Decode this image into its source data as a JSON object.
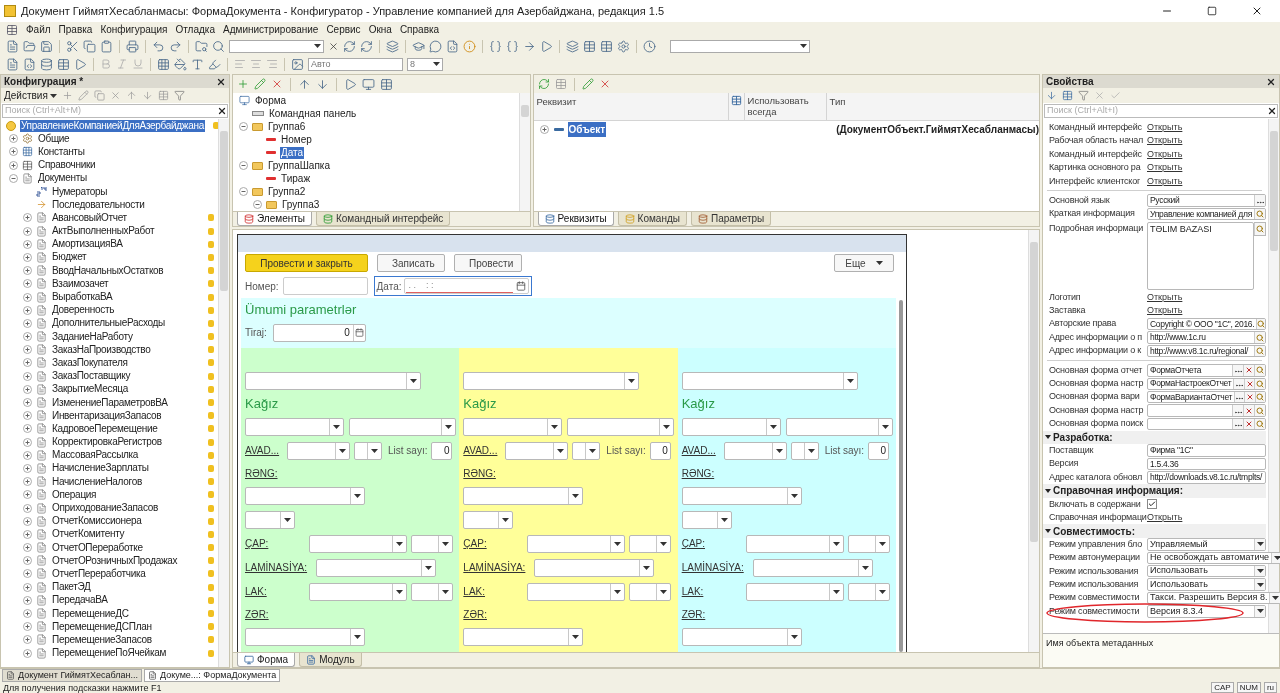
{
  "window": {
    "title": "Документ ГиймятХесабланмасы: ФормаДокумента - Конфигуратор - Управление компанией для Азербайджана, редакция 1.5"
  },
  "menu": [
    "Файл",
    "Правка",
    "Конфигурация",
    "Отладка",
    "Администрирование",
    "Сервис",
    "Окна",
    "Справка"
  ],
  "toolbar": {
    "font_field": "Авто",
    "size_field": "8"
  },
  "config_panel": {
    "title": "Конфигурация *",
    "actions": "Действия",
    "search": {
      "placeholder": "Поиск (Ctrl+Alt+M)"
    },
    "tree": [
      {
        "label": "УправлениеКомпаниейДляАзербайджана",
        "kind": "root",
        "selected": true,
        "locked": true,
        "children": [
          {
            "label": "Общие",
            "kind": "common",
            "selected": false,
            "locked": false,
            "expanded": false
          },
          {
            "label": "Константы",
            "kind": "constants",
            "selected": false,
            "locked": false,
            "expanded": false
          },
          {
            "label": "Справочники",
            "kind": "catalogs",
            "selected": false,
            "locked": false,
            "expanded": false
          },
          {
            "label": "Документы",
            "kind": "documents",
            "selected": false,
            "locked": false,
            "expanded": true,
            "children": [
              {
                "label": "Нумераторы",
                "kind": "numerators",
                "selected": false,
                "locked": false
              },
              {
                "label": "Последовательности",
                "kind": "sequences",
                "selected": false,
                "locked": false
              },
              {
                "label": "АвансовыйОтчет",
                "kind": "document",
                "selected": false,
                "locked": true,
                "expanded": false
              },
              {
                "label": "АктВыполненныхРабот",
                "kind": "document",
                "selected": false,
                "locked": true,
                "expanded": false
              },
              {
                "label": "АмортизацияВА",
                "kind": "document",
                "selected": false,
                "locked": true,
                "expanded": false
              },
              {
                "label": "Бюджет",
                "kind": "document",
                "selected": false,
                "locked": true,
                "expanded": false
              },
              {
                "label": "ВводНачальныхОстатков",
                "kind": "document",
                "selected": false,
                "locked": true,
                "expanded": false
              },
              {
                "label": "Взаимозачет",
                "kind": "document",
                "selected": false,
                "locked": true,
                "expanded": false
              },
              {
                "label": "ВыработкаВА",
                "kind": "document",
                "selected": false,
                "locked": true,
                "expanded": false
              },
              {
                "label": "Доверенность",
                "kind": "document",
                "selected": false,
                "locked": true,
                "expanded": false
              },
              {
                "label": "ДополнительныеРасходы",
                "kind": "document",
                "selected": false,
                "locked": true,
                "expanded": false
              },
              {
                "label": "ЗаданиеНаРаботу",
                "kind": "document",
                "selected": false,
                "locked": true,
                "expanded": false
              },
              {
                "label": "ЗаказНаПроизводство",
                "kind": "document",
                "selected": false,
                "locked": true,
                "expanded": false
              },
              {
                "label": "ЗаказПокупателя",
                "kind": "document",
                "selected": false,
                "locked": true,
                "expanded": false
              },
              {
                "label": "ЗаказПоставщику",
                "kind": "document",
                "selected": false,
                "locked": true,
                "expanded": false
              },
              {
                "label": "ЗакрытиеМесяца",
                "kind": "document",
                "selected": false,
                "locked": true,
                "expanded": false
              },
              {
                "label": "ИзменениеПараметровВА",
                "kind": "document",
                "selected": false,
                "locked": true,
                "expanded": false
              },
              {
                "label": "ИнвентаризацияЗапасов",
                "kind": "document",
                "selected": false,
                "locked": true,
                "expanded": false
              },
              {
                "label": "КадровоеПеремещение",
                "kind": "document",
                "selected": false,
                "locked": true,
                "expanded": false
              },
              {
                "label": "КорректировкаРегистров",
                "kind": "document",
                "selected": false,
                "locked": true,
                "expanded": false
              },
              {
                "label": "МассоваяРассылка",
                "kind": "document",
                "selected": false,
                "locked": true,
                "expanded": false
              },
              {
                "label": "НачислениеЗарплаты",
                "kind": "document",
                "selected": false,
                "locked": true,
                "expanded": false
              },
              {
                "label": "НачислениеНалогов",
                "kind": "document",
                "selected": false,
                "locked": true,
                "expanded": false
              },
              {
                "label": "Операция",
                "kind": "document",
                "selected": false,
                "locked": true,
                "expanded": false
              },
              {
                "label": "ОприходованиеЗапасов",
                "kind": "document",
                "selected": false,
                "locked": true,
                "expanded": false
              },
              {
                "label": "ОтчетКомиссионера",
                "kind": "document",
                "selected": false,
                "locked": true,
                "expanded": false
              },
              {
                "label": "ОтчетКомитенту",
                "kind": "document",
                "selected": false,
                "locked": true,
                "expanded": false
              },
              {
                "label": "ОтчетОПереработке",
                "kind": "document",
                "selected": false,
                "locked": true,
                "expanded": false
              },
              {
                "label": "ОтчетОРозничныхПродажах",
                "kind": "document",
                "selected": false,
                "locked": true,
                "expanded": false
              },
              {
                "label": "ОтчетПереработчика",
                "kind": "document",
                "selected": false,
                "locked": true,
                "expanded": false
              },
              {
                "label": "ПакетЭД",
                "kind": "document",
                "selected": false,
                "locked": true,
                "expanded": false
              },
              {
                "label": "ПередачаВА",
                "kind": "document",
                "selected": false,
                "locked": true,
                "expanded": false
              },
              {
                "label": "ПеремещениеДС",
                "kind": "document",
                "selected": false,
                "locked": true,
                "expanded": false
              },
              {
                "label": "ПеремещениеДСПлан",
                "kind": "document",
                "selected": false,
                "locked": true,
                "expanded": false
              },
              {
                "label": "ПеремещениеЗапасов",
                "kind": "document",
                "selected": false,
                "locked": true,
                "expanded": false
              },
              {
                "label": "ПеремещениеПоЯчейкам",
                "kind": "document",
                "selected": false,
                "locked": true,
                "expanded": false
              }
            ]
          }
        ]
      }
    ]
  },
  "elements_panel": {
    "tree": [
      {
        "label": "Форма",
        "kind": "form",
        "selected": false,
        "children": [
          {
            "label": "Командная панель",
            "kind": "command-bar",
            "selected": false
          },
          {
            "label": "Группа6",
            "kind": "group",
            "selected": false,
            "expanded": true,
            "children": [
              {
                "label": "Номер",
                "kind": "field",
                "selected": false
              },
              {
                "label": "Дата",
                "kind": "field",
                "selected": true
              }
            ]
          },
          {
            "label": "ГруппаШапка",
            "kind": "group",
            "selected": false,
            "expanded": true,
            "children": [
              {
                "label": "Тираж",
                "kind": "field",
                "selected": false
              }
            ]
          },
          {
            "label": "Группа2",
            "kind": "group",
            "selected": false,
            "expanded": true,
            "children": [
              {
                "label": "Группа3",
                "kind": "group",
                "selected": false,
                "expanded": true
              }
            ]
          }
        ]
      }
    ],
    "tabs": [
      {
        "label": "Элементы",
        "selected": true
      },
      {
        "label": "Командный интерфейс",
        "selected": false
      }
    ]
  },
  "attributes_panel": {
    "columns": [
      "Реквизит",
      "Использовать всегда",
      "Тип"
    ],
    "rows": [
      {
        "name": "Объект",
        "type": "(ДокументОбъект.ГиймятХесабланмасы)",
        "selected": true
      }
    ],
    "tabs": [
      {
        "label": "Реквизиты",
        "selected": true
      },
      {
        "label": "Команды",
        "selected": false
      },
      {
        "label": "Параметры",
        "selected": false
      }
    ]
  },
  "form_preview": {
    "buttons": [
      {
        "label": "Провести и закрыть",
        "kind": "primary"
      },
      {
        "label": "Записать",
        "kind": "normal"
      },
      {
        "label": "Провести",
        "kind": "normal"
      }
    ],
    "more_button": "Еще",
    "number_label": "Номер:",
    "date_label": "Дата:",
    "date_mask": ". .    : :",
    "section_title": "Ümumi parametrlər",
    "tiraj_label": "Tiraj:",
    "tiraj_value": "0",
    "columns": [
      {
        "color": "#ccffcc",
        "paper_title": "Kağız",
        "avad": "AVAD...",
        "list_label": "List sayı:",
        "list_value": "0",
        "reng": "RƏNG:",
        "cap": "ÇAP:",
        "laminasiya": "LAMİNASİYA:",
        "lak": "LAK:",
        "zer": "ZƏR:"
      },
      {
        "color": "#ffff99",
        "paper_title": "Kağız",
        "avad": "AVAD...",
        "list_label": "List sayı:",
        "list_value": "0",
        "reng": "RƏNG:",
        "cap": "ÇAP:",
        "laminasiya": "LAMİNASİYA:",
        "lak": "LAK:",
        "zer": "ZƏR:"
      },
      {
        "color": "#ccffff",
        "paper_title": "Kağız",
        "avad": "AVAD...",
        "list_label": "List sayı:",
        "list_value": "0",
        "reng": "RƏNG:",
        "cap": "ÇAP:",
        "laminasiya": "LAMİNASİYA:",
        "lak": "LAK:",
        "zer": "ZƏR:"
      }
    ]
  },
  "designer_tabs": [
    {
      "label": "Форма",
      "selected": true
    },
    {
      "label": "Модуль",
      "selected": false
    }
  ],
  "properties_panel": {
    "title": "Свойства",
    "search": {
      "placeholder": "Поиск (Ctrl+Alt+I)"
    },
    "rows": [
      {
        "kind": "link",
        "label": "Командный интерфейс",
        "value": "Открыть"
      },
      {
        "kind": "link",
        "label": "Рабочая область начал",
        "value": "Открыть"
      },
      {
        "kind": "link",
        "label": "Командный интерфейс",
        "value": "Открыть"
      },
      {
        "kind": "link",
        "label": "Картинка основного ра",
        "value": "Открыть"
      },
      {
        "kind": "link",
        "label": "Интерфейс клиентског",
        "value": "Открыть"
      },
      {
        "kind": "divider"
      },
      {
        "kind": "field",
        "label": "Основной язык",
        "value": "Русский",
        "buttons": [
          {
            "kind": "ellipsis"
          }
        ]
      },
      {
        "kind": "field",
        "label": "Краткая информация",
        "value": "Управление компанией для",
        "buttons": [
          {
            "kind": "search"
          }
        ]
      },
      {
        "kind": "textarea",
        "label": "Подробная информаци",
        "value": "TƏLIM BAZASI",
        "buttons": [
          {
            "kind": "search"
          }
        ]
      },
      {
        "kind": "link",
        "label": "Логотип",
        "value": "Открыть"
      },
      {
        "kind": "link",
        "label": "Заставка",
        "value": "Открыть"
      },
      {
        "kind": "field",
        "label": "Авторские права",
        "value": "Copyright © ООО \"1С\", 2016.",
        "buttons": [
          {
            "kind": "search"
          }
        ]
      },
      {
        "kind": "field",
        "label": "Адрес информации о п",
        "value": "http://www.1c.ru",
        "buttons": [
          {
            "kind": "search"
          }
        ]
      },
      {
        "kind": "field",
        "label": "Адрес информации о к",
        "value": "http://www.v8.1c.ru/regional/",
        "buttons": [
          {
            "kind": "search"
          }
        ]
      },
      {
        "kind": "divider"
      },
      {
        "kind": "field",
        "label": "Основная форма отчет",
        "value": "ФормаОтчета",
        "buttons": [
          {
            "kind": "ellipsis"
          },
          {
            "kind": "clear"
          },
          {
            "kind": "search"
          }
        ]
      },
      {
        "kind": "field",
        "label": "Основная форма настр",
        "value": "ФормаНастроекОтчет",
        "buttons": [
          {
            "kind": "ellipsis"
          },
          {
            "kind": "clear"
          },
          {
            "kind": "search"
          }
        ]
      },
      {
        "kind": "field",
        "label": "Основная форма вари",
        "value": "ФормаВариантаОтчет",
        "buttons": [
          {
            "kind": "ellipsis"
          },
          {
            "kind": "clear"
          },
          {
            "kind": "search"
          }
        ]
      },
      {
        "kind": "field",
        "label": "Основная форма настр",
        "buttons": [
          {
            "kind": "ellipsis"
          },
          {
            "kind": "clear"
          },
          {
            "kind": "search"
          }
        ]
      },
      {
        "kind": "field",
        "label": "Основная форма поиск",
        "buttons": [
          {
            "kind": "ellipsis"
          },
          {
            "kind": "clear"
          },
          {
            "kind": "search"
          }
        ]
      },
      {
        "kind": "section",
        "label": "Разработка:",
        "expanded": true
      },
      {
        "kind": "field",
        "label": "Поставщик",
        "value": "Фирма \"1С\""
      },
      {
        "kind": "field",
        "label": "Версия",
        "value": "1.5.4.36"
      },
      {
        "kind": "field",
        "label": "Адрес каталога обновл",
        "value": "http://downloads.v8.1c.ru/tmplts/"
      },
      {
        "kind": "section",
        "label": "Справочная информация:",
        "expanded": true
      },
      {
        "kind": "checkbox",
        "label": "Включать в содержани",
        "checked": true
      },
      {
        "kind": "link",
        "label": "Справочная информаци",
        "value": "Открыть"
      },
      {
        "kind": "section",
        "label": "Совместимость:",
        "expanded": true
      },
      {
        "kind": "select",
        "label": "Режим управления бло",
        "value": "Управляемый",
        "circled": false
      },
      {
        "kind": "select",
        "label": "Режим автонумерации",
        "value": "Не освобождать автоматиче",
        "circled": false
      },
      {
        "kind": "select",
        "label": "Режим использования",
        "value": "Использовать",
        "circled": false
      },
      {
        "kind": "select",
        "label": "Режим использования",
        "value": "Использовать",
        "circled": false
      },
      {
        "kind": "select",
        "label": "Режим совместимости",
        "value": "Такси. Разрешить Версия 8.",
        "circled": false
      },
      {
        "kind": "select",
        "label": "Режим совместимости",
        "value": "Версия 8.3.4",
        "circled": true
      }
    ],
    "description": "Имя объекта метаданных"
  },
  "taskbar": [
    {
      "label": "Документ ГиймятХесаблан...",
      "selected": false
    },
    {
      "label": "Докуме...: ФормаДокумента",
      "selected": true
    }
  ],
  "status_bar": {
    "hint": "Для получения подсказки нажмите F1",
    "indicators": [
      "CAP",
      "NUM",
      "ru"
    ]
  }
}
